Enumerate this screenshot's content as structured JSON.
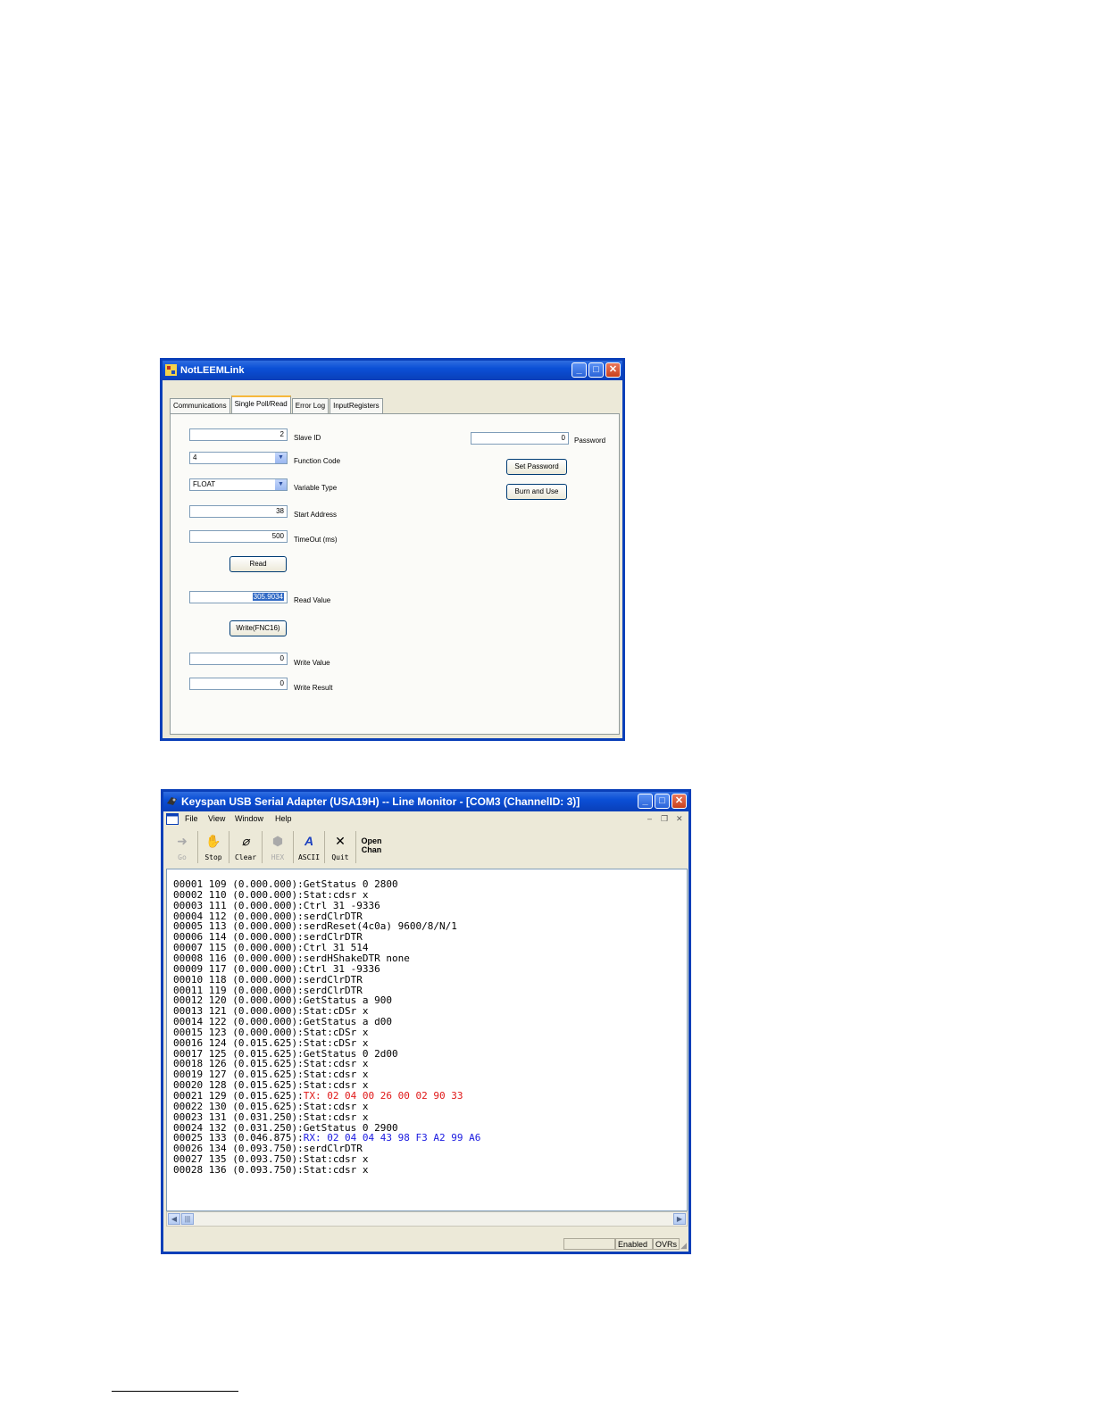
{
  "win1": {
    "title": "NotLEEMLink",
    "tabs": [
      "Communications",
      "Single Poll/Read",
      "Error Log",
      "InputRegisters"
    ],
    "active_tab": 1,
    "slave_id": "2",
    "slave_id_label": "Slave ID",
    "function_code": "4",
    "function_code_label": "Function Code",
    "variable_type": "FLOAT",
    "variable_type_label": "Variable Type",
    "start_address": "38",
    "start_address_label": "Start Address",
    "timeout": "500",
    "timeout_label": "TimeOut (ms)",
    "read_button": "Read",
    "read_value": "305.9034",
    "read_value_label": "Read Value",
    "write_button": "Write(FNC16)",
    "write_value": "0",
    "write_value_label": "Write Value",
    "write_result": "0",
    "write_result_label": "Write Result",
    "password": "0",
    "password_label": "Password",
    "set_password_button": "Set Password",
    "burn_button": "Burn and Use"
  },
  "win2": {
    "title": "Keyspan USB Serial Adapter (USA19H) -- Line Monitor - [COM3 (ChannelID: 3)]",
    "menu": [
      "File",
      "View",
      "Window",
      "Help"
    ],
    "toolbar": [
      {
        "icon": "go-icon",
        "label": "Go",
        "enabled": false
      },
      {
        "icon": "stop-hand-icon",
        "label": "Stop",
        "enabled": true
      },
      {
        "icon": "clear-eraser-icon",
        "label": "Clear",
        "enabled": true
      },
      {
        "icon": "hex-icon",
        "label": "HEX",
        "enabled": false
      },
      {
        "icon": "ascii-icon",
        "label": "ASCII",
        "enabled": true
      },
      {
        "icon": "quit-icon",
        "label": "Quit",
        "enabled": true
      },
      {
        "icon": "open-chan-icon",
        "label": "Open Chan",
        "enabled": true
      }
    ],
    "log": [
      {
        "n": "00001 109 (0.000.000)",
        "msg": ":GetStatus 0 2800"
      },
      {
        "n": "00002 110 (0.000.000)",
        "msg": ":Stat:cdsr x"
      },
      {
        "n": "00003 111 (0.000.000)",
        "msg": ":Ctrl 31 -9336"
      },
      {
        "n": "00004 112 (0.000.000)",
        "msg": ":serdClrDTR"
      },
      {
        "n": "00005 113 (0.000.000)",
        "msg": ":serdReset(4c0a) 9600/8/N/1"
      },
      {
        "n": "00006 114 (0.000.000)",
        "msg": ":serdClrDTR"
      },
      {
        "n": "00007 115 (0.000.000)",
        "msg": ":Ctrl 31 514"
      },
      {
        "n": "00008 116 (0.000.000)",
        "msg": ":serdHShakeDTR none"
      },
      {
        "n": "00009 117 (0.000.000)",
        "msg": ":Ctrl 31 -9336"
      },
      {
        "n": "00010 118 (0.000.000)",
        "msg": ":serdClrDTR"
      },
      {
        "n": "00011 119 (0.000.000)",
        "msg": ":serdClrDTR"
      },
      {
        "n": "00012 120 (0.000.000)",
        "msg": ":GetStatus a 900"
      },
      {
        "n": "00013 121 (0.000.000)",
        "msg": ":Stat:cDSr x"
      },
      {
        "n": "00014 122 (0.000.000)",
        "msg": ":GetStatus a d00"
      },
      {
        "n": "00015 123 (0.000.000)",
        "msg": ":Stat:cDSr x"
      },
      {
        "n": "00016 124 (0.015.625)",
        "msg": ":Stat:cDSr x"
      },
      {
        "n": "00017 125 (0.015.625)",
        "msg": ":GetStatus 0 2d00"
      },
      {
        "n": "00018 126 (0.015.625)",
        "msg": ":Stat:cdsr x"
      },
      {
        "n": "00019 127 (0.015.625)",
        "msg": ":Stat:cdsr x"
      },
      {
        "n": "00020 128 (0.015.625)",
        "msg": ":Stat:cdsr x"
      },
      {
        "n": "00021 129 (0.015.625)",
        "msg": ":",
        "tx": "TX: 02 04 00 26 00 02 90 33"
      },
      {
        "n": "00022 130 (0.015.625)",
        "msg": ":Stat:cdsr x"
      },
      {
        "n": "00023 131 (0.031.250)",
        "msg": ":Stat:cdsr x"
      },
      {
        "n": "00024 132 (0.031.250)",
        "msg": ":GetStatus 0 2900"
      },
      {
        "n": "00025 133 (0.046.875)",
        "msg": ":",
        "rx": "RX: 02 04 04 43 98 F3 A2 99 A6"
      },
      {
        "n": "00026 134 (0.093.750)",
        "msg": ":serdClrDTR"
      },
      {
        "n": "00027 135 (0.093.750)",
        "msg": ":Stat:cdsr x"
      },
      {
        "n": "00028 136 (0.093.750)",
        "msg": ":Stat:cdsr x"
      }
    ],
    "status": [
      "Enabled",
      "OVRs"
    ],
    "colors": {
      "tx": "#e01818",
      "rx": "#1a1ae0"
    }
  }
}
